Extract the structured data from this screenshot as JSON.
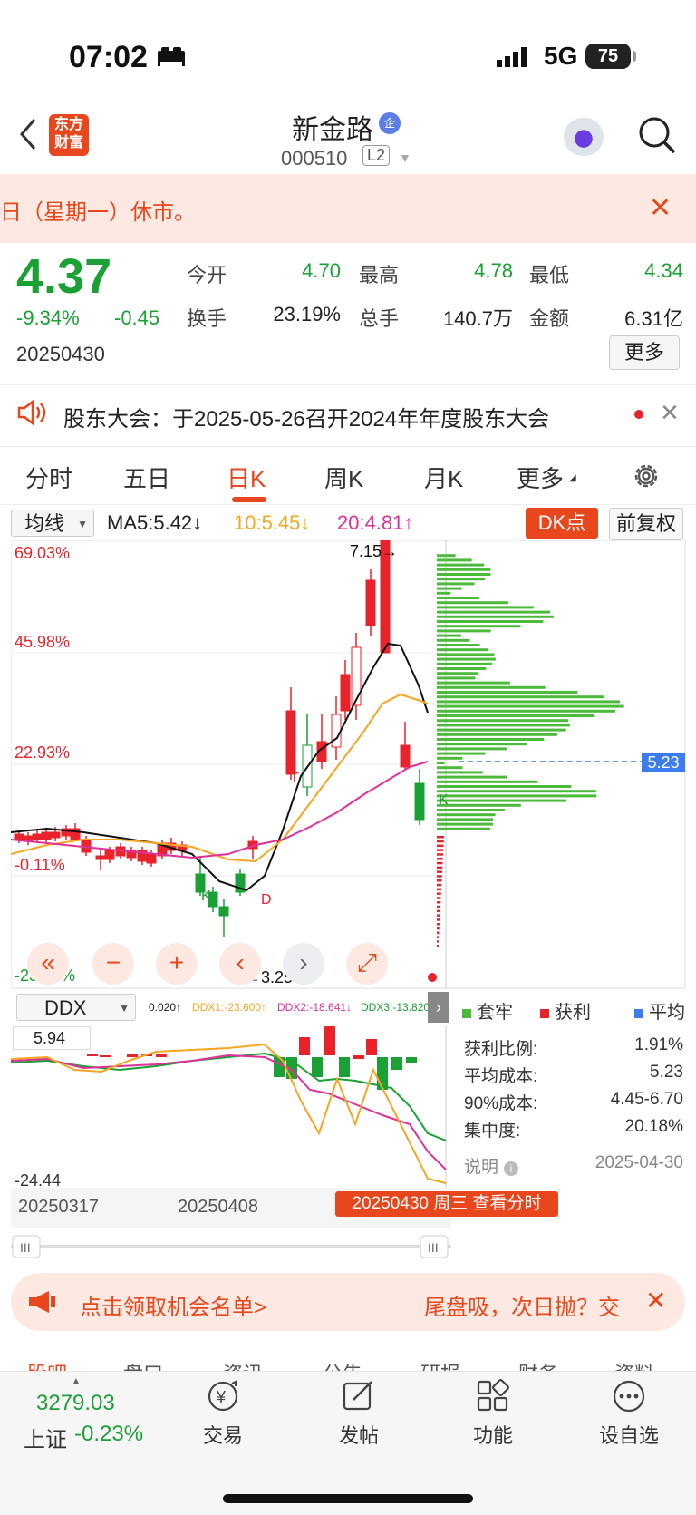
{
  "status_bar": {
    "time": "07:02",
    "network": "5G",
    "battery": "75"
  },
  "nav": {
    "logo_text": "东方财富",
    "stock_name": "新金路",
    "qi_badge": "企",
    "stock_code": "000510",
    "level": "L2"
  },
  "notice": {
    "text": "日（星期一）休市。",
    "close": "✕"
  },
  "quote": {
    "price": "4.37",
    "change_pct": "-9.34%",
    "change": "-0.45",
    "date": "20250430",
    "fields": [
      {
        "label": "今开",
        "value": "4.70"
      },
      {
        "label": "最高",
        "value": "4.78"
      },
      {
        "label": "最低",
        "value": "4.34"
      },
      {
        "label": "换手",
        "value": "23.19%"
      },
      {
        "label": "总手",
        "value": "140.7万"
      },
      {
        "label": "金额",
        "value": "6.31亿"
      }
    ],
    "more_label": "更多"
  },
  "announcement": {
    "text": "股东大会：于2025-05-26召开2024年年度股东大会",
    "close": "✕"
  },
  "tabs": [
    "分时",
    "五日",
    "日K",
    "周K",
    "月K",
    "更多"
  ],
  "indicator_row": {
    "select": "均线",
    "ma5": "MA5:5.42↓",
    "ma10": "10:5.45↓",
    "ma20": "20:4.81↑",
    "dk_label": "DK点",
    "fq_label": "前复权"
  },
  "kline_labels": {
    "top_pct": "69.03%",
    "p2": "45.98%",
    "p3": "22.93%",
    "p4": "-0.11%",
    "bottom_pct": "-23.16%",
    "high_mark": "7.15→",
    "low_mark": "←3.25",
    "cost_tag": "5.23",
    "t1": "T",
    "t2": "T",
    "k1": "K",
    "k2": "K",
    "d1": "D"
  },
  "ddx": {
    "select": "DDX",
    "v0": "0.020↑",
    "v1": "DDX1:-23.600↑",
    "v2": "DDX2:-18.641↓",
    "v3": "DDX3:-13.820",
    "top": "5.94",
    "bottom": "-24.44"
  },
  "chip_legend": [
    "套牢",
    "获利",
    "平均"
  ],
  "chip_stats": [
    {
      "label": "获利比例:",
      "value": "1.91%"
    },
    {
      "label": "平均成本:",
      "value": "5.23"
    },
    {
      "label": "90%成本:",
      "value": "4.45-6.70"
    },
    {
      "label": "集中度:",
      "value": "20.18%"
    }
  ],
  "chip_note": {
    "label": "说明",
    "date": "2025-04-30"
  },
  "dates": {
    "d1": "20250317",
    "d2": "20250408",
    "badge": "20250430 周三 查看分时"
  },
  "banner": {
    "left": "点击领取机会名单>",
    "right": "尾盘吸，次日抛？交"
  },
  "sub_tabs": [
    "股吧",
    "盘口",
    "资讯",
    "公告",
    "研报",
    "财务",
    "资料"
  ],
  "bottom_bar": {
    "index_value": "3279.03",
    "index_name": "上证",
    "index_change": "-0.23%",
    "items": [
      "交易",
      "发帖",
      "功能",
      "设自选"
    ]
  },
  "colors": {
    "up": "#e8232b",
    "down": "#1aa035",
    "accent": "#e8471d",
    "ma10": "#f5a623",
    "ma20": "#e0309a"
  }
}
